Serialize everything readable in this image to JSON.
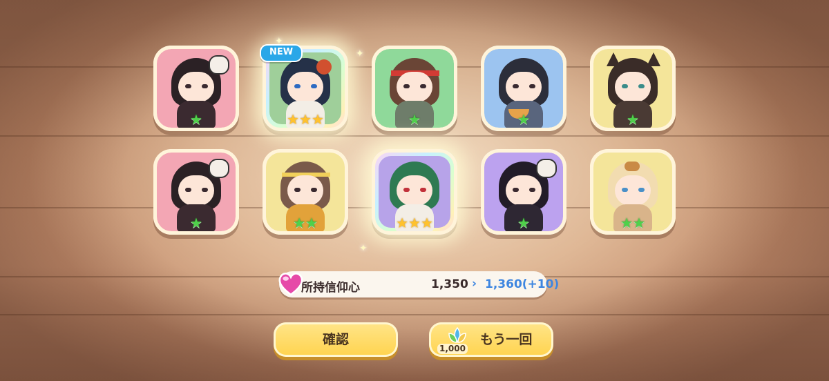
{
  "new_badge": "NEW",
  "cards": [
    {
      "id": "r1c1",
      "bg": "pink",
      "stars": "★",
      "star_type": "green"
    },
    {
      "id": "r1c2",
      "bg": "rainbow",
      "stars": "★★★",
      "star_type": "gold",
      "new": true
    },
    {
      "id": "r1c3",
      "bg": "green",
      "stars": "★",
      "star_type": "green"
    },
    {
      "id": "r1c4",
      "bg": "blue",
      "stars": "★",
      "star_type": "green"
    },
    {
      "id": "r1c5",
      "bg": "yellow",
      "stars": "★",
      "star_type": "green"
    },
    {
      "id": "r2c1",
      "bg": "pink",
      "stars": "★",
      "star_type": "green"
    },
    {
      "id": "r2c2",
      "bg": "yellow",
      "stars": "★★",
      "star_type": "green"
    },
    {
      "id": "r2c3",
      "bg": "rainbow",
      "stars": "★★★",
      "star_type": "gold"
    },
    {
      "id": "r2c4",
      "bg": "purple",
      "stars": "★",
      "star_type": "green"
    },
    {
      "id": "r2c5",
      "bg": "yellow",
      "stars": "★★",
      "star_type": "green"
    }
  ],
  "faith": {
    "label": "所持信仰心",
    "current": "1,350",
    "arrow": "›",
    "new_value": "1,360(+10)"
  },
  "buttons": {
    "confirm_label": "確認",
    "again_label": "もう一回",
    "again_cost": "1,000"
  }
}
